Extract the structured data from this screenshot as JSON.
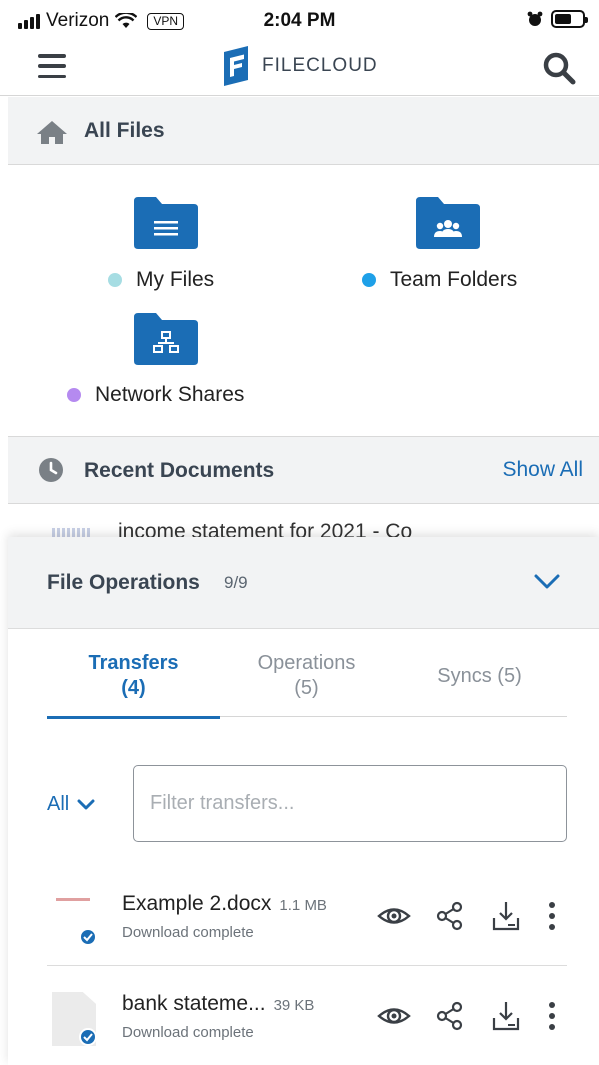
{
  "status_bar": {
    "carrier": "Verizon",
    "vpn": "VPN",
    "time": "2:04 PM"
  },
  "header": {
    "app_name": "FILECLOUD",
    "brand_color": "#1b6db5"
  },
  "all_files": {
    "title": "All Files",
    "folders": [
      {
        "label": "My Files",
        "dot_color": "#a6dde3",
        "icon": "folder-document-icon"
      },
      {
        "label": "Team Folders",
        "dot_color": "#1ea0e8",
        "icon": "folder-team-icon"
      },
      {
        "label": "Network Shares",
        "dot_color": "#b58af0",
        "icon": "folder-network-icon"
      }
    ]
  },
  "recent": {
    "title": "Recent Documents",
    "show_all": "Show All",
    "first_item": "income statement for 2021 - Co"
  },
  "file_operations": {
    "title": "File Operations",
    "count": "9/9",
    "tabs": [
      {
        "label": "Transfers",
        "count": "(4)",
        "active": true
      },
      {
        "label": "Operations",
        "count": "(5)",
        "active": false
      },
      {
        "label": "Syncs (5)",
        "active": false
      }
    ],
    "filter": {
      "scope": "All",
      "placeholder": "Filter transfers..."
    },
    "transfers": [
      {
        "name": "Example 2.docx",
        "size": "1.1 MB",
        "status": "Download complete"
      },
      {
        "name": "bank stateme...",
        "size": "39 KB",
        "status": "Download complete"
      }
    ]
  }
}
